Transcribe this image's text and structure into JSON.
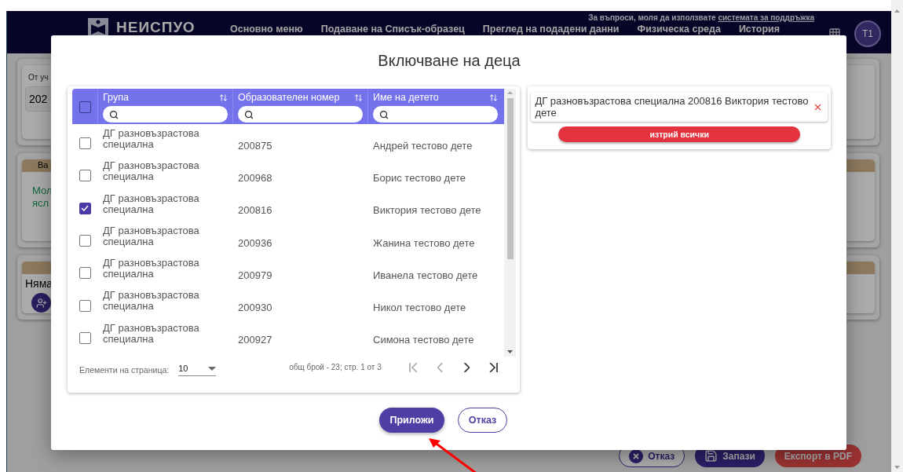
{
  "header": {
    "help_text": "За въпроси, моля да използвате",
    "help_link": "системата за поддръжка",
    "logo_text": "НЕИСПУО",
    "nav": [
      "Основно меню",
      "Подаване на Списък-образец",
      "Преглед на подадени данни",
      "Физическа среда",
      "История"
    ],
    "avatar": "Т1"
  },
  "filter_card": {
    "label": "От уч",
    "value": "202"
  },
  "info_card": {
    "heading": "Ва",
    "message_lines": [
      "Мол",
      "ясл"
    ]
  },
  "children_card": {
    "text": "Няма"
  },
  "footer_buttons": [
    {
      "kind": "cancel",
      "label": "Отказ"
    },
    {
      "kind": "save",
      "label": "Запази"
    },
    {
      "kind": "export",
      "label": "Експорт в PDF"
    }
  ],
  "dialog": {
    "title": "Включване на деца",
    "table": {
      "select_all": {
        "checked": false
      },
      "columns": [
        "Група",
        "Образователен номер",
        "Име на детето"
      ],
      "rows": [
        {
          "group": "ДГ разновъзрастова специална",
          "number": "200875",
          "name": "Андрей тестово дете",
          "checked": false
        },
        {
          "group": "ДГ разновъзрастова специална",
          "number": "200968",
          "name": "Борис тестово дете",
          "checked": false
        },
        {
          "group": "ДГ разновъзрастова специална",
          "number": "200816",
          "name": "Виктория тестово дете",
          "checked": true
        },
        {
          "group": "ДГ разновъзрастова специална",
          "number": "200936",
          "name": "Жанина тестово дете",
          "checked": false
        },
        {
          "group": "ДГ разновъзрастова специална",
          "number": "200979",
          "name": "Иванела тестово дете",
          "checked": false
        },
        {
          "group": "ДГ разновъзрастова специална",
          "number": "200930",
          "name": "Никол тестово дете",
          "checked": false
        },
        {
          "group": "ДГ разновъзрастова специална",
          "number": "200927",
          "name": "Симона тестово дете",
          "checked": false
        }
      ]
    },
    "pager": {
      "label": "Елементи на страница:",
      "page_size": "10",
      "summary": "общ брой - 23; стр. 1 от 3",
      "buttons": [
        {
          "kind": "first",
          "disabled": true
        },
        {
          "kind": "prev",
          "disabled": true
        },
        {
          "kind": "next",
          "disabled": false
        },
        {
          "kind": "last",
          "disabled": false
        }
      ]
    },
    "selected": [
      {
        "text": "ДГ разновъзрастова специална 200816 Виктория тестово дете"
      }
    ],
    "clear_button": "изтрий всички",
    "buttons": [
      {
        "kind": "primary",
        "label": "Приложи"
      },
      {
        "kind": "outline",
        "label": "Отказ"
      }
    ]
  }
}
